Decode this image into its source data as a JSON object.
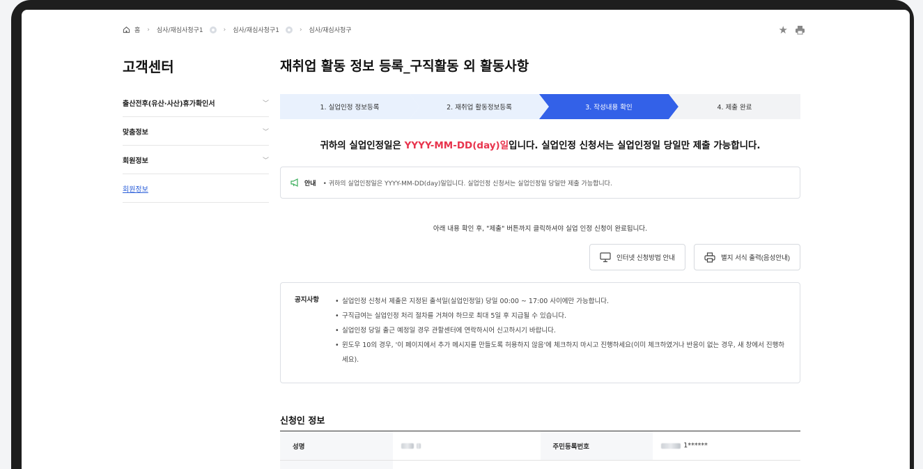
{
  "breadcrumb": {
    "home": "홈",
    "items": [
      "심사/재심사청구1",
      "심사/재심사청구1",
      "심사/재심사청구"
    ]
  },
  "sidebar": {
    "title": "고객센터",
    "items": [
      {
        "label": "출산전후(유산·사산)휴가확인서",
        "has_chevron": true
      },
      {
        "label": "맞춤정보",
        "has_chevron": true
      },
      {
        "label": "회원정보",
        "has_chevron": true
      },
      {
        "label": "회원정보",
        "is_link": true
      }
    ]
  },
  "main": {
    "title": "재취업 활동 정보 등록_구직활동 외 활동사항",
    "steps": [
      {
        "label": "1. 실업인정 정보등록",
        "state": "done"
      },
      {
        "label": "2. 재취업 활동정보등록",
        "state": "done"
      },
      {
        "label": "3. 작성내용 확인",
        "state": "active"
      },
      {
        "label": "4. 제출 완료",
        "state": "pending"
      }
    ],
    "notice_big": {
      "prefix": "귀하의 실업인정일은 ",
      "date": "YYYY-MM-DD(day)",
      "date_suffix": "일",
      "rest": "입니다. 실업인정 신청서는 실업인정일 당일만 제출 가능합니다."
    },
    "info_box": {
      "label": "안내",
      "text": "• 귀하의 실업인정일은 YYYY-MM-DD(day)일입니다. 실업인정 신청서는 실업인정일 당일만 제출 가능합니다."
    },
    "confirm_text": "아래 내용 확인 후, \"제출\" 버튼까지 클릭하셔야 실업 인정 신청이 완료됩니다.",
    "buttons": {
      "internet_guide": "인터넷 신청방법 안내",
      "print_form": "별지 서식 출력(음성안내)"
    },
    "notices": {
      "title": "공지사항",
      "items": [
        "실업인정 신청서 제출은 지정된 출석일(실업인정일) 당일 00:00 ~ 17:00 사이에만 가능합니다.",
        "구직급여는 실업인정 처리 절차를 거쳐야 하므로 최대 5일 후 지급될 수 있습니다.",
        "실업인정 당일 출근 예정일 경우 관할센터에 연락하시어 신고하시기 바랍니다.",
        "윈도우 10의 경우, '이 페이지에서 추가 메시지를 만들도록 허용하지 않음'에 체크하지 마시고 진행하세요(이미 체크하였거나 반응이 없는 경우, 새 창에서 진행하세요)."
      ]
    },
    "applicant": {
      "section_title": "신청인 정보",
      "name_label": "성명",
      "rrn_label": "주민등록번호",
      "rrn_value": "1******"
    }
  },
  "colors": {
    "step_done": "#e9f1fd",
    "step_active": "#3361e8",
    "step_pending": "#f2f3f5",
    "accent_red": "#e8344d"
  }
}
